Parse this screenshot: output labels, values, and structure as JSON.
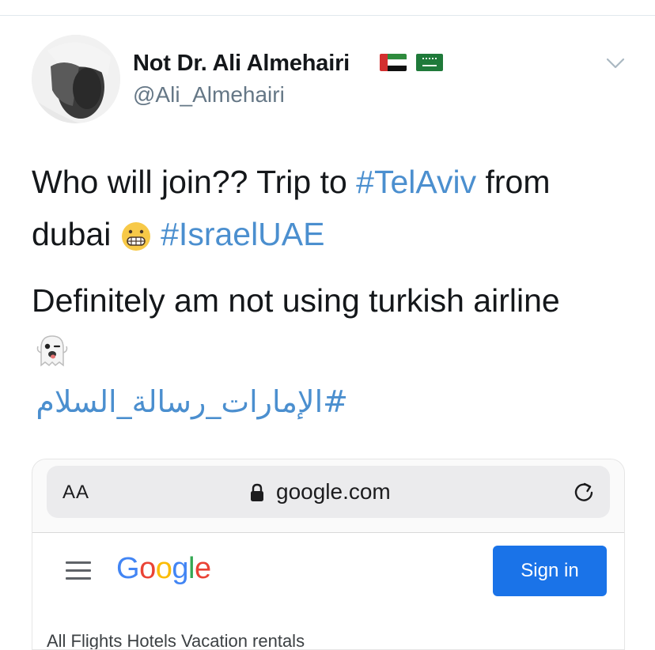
{
  "tweet": {
    "author_name": "Not Dr. Ali Almehairi",
    "handle": "@Ali_Almehairi",
    "line1_text": "Who will join?? Trip to ",
    "line1_tag": "#TelAviv",
    "line1_after": " from",
    "line2_text": "dubai ",
    "line2_tag": "#IsraelUAE",
    "line3_text": "Definitely am not using turkish airline",
    "arabic_tag": "#الإمارات_رسالة_السلام"
  },
  "icons": {
    "avatar": "profile-photo",
    "flag_1": "uae-flag-icon",
    "flag_2": "saudi-flag-icon",
    "more": "chevron-down-icon",
    "emoji_1": "grimacing-face-emoji",
    "emoji_2": "ghost-emoji"
  },
  "embedded_screenshot": {
    "text_size_button": "AA",
    "url": "google.com",
    "logo": "Google",
    "sign_in_label": "Sign in",
    "partial_nav": "All   Flights   Hotels   Vacation rentals"
  },
  "colors": {
    "link_blue": "#4b8fcf",
    "google_blue": "#1a73e8"
  }
}
